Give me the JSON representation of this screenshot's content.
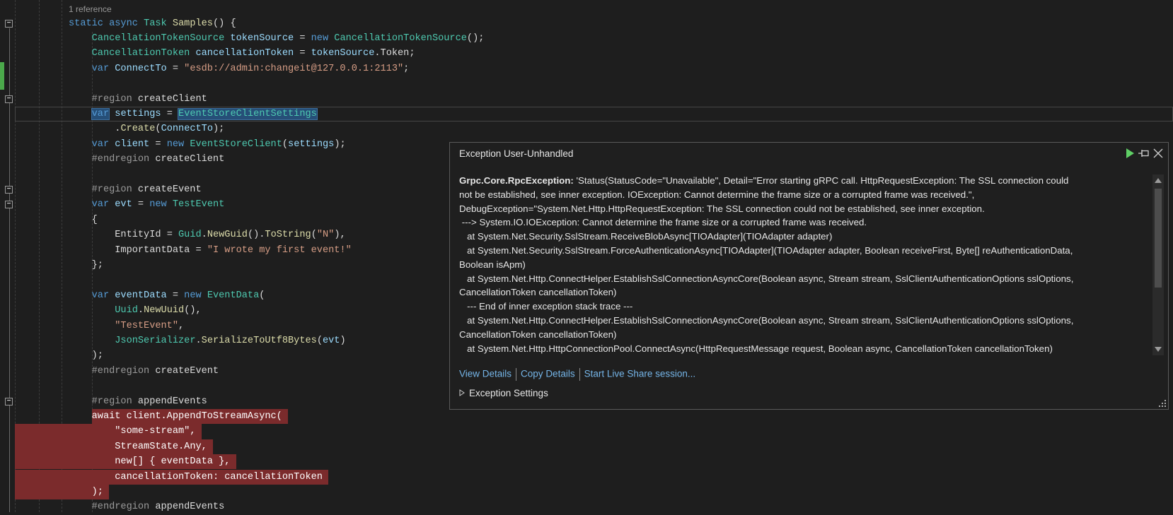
{
  "editor": {
    "codelens": "1 reference",
    "lines": [
      {
        "i": 0,
        "t": [
          [
            "static ",
            "k"
          ],
          [
            "async ",
            "k"
          ],
          [
            "Task ",
            "t"
          ],
          [
            "Samples",
            "m"
          ],
          [
            "() {",
            "d"
          ]
        ]
      },
      {
        "i": 4,
        "t": [
          [
            "CancellationTokenSource ",
            "t"
          ],
          [
            "tokenSource",
            "v"
          ],
          [
            " = ",
            "d"
          ],
          [
            "new ",
            "k"
          ],
          [
            "CancellationTokenSource",
            "t"
          ],
          [
            "();",
            "d"
          ]
        ]
      },
      {
        "i": 4,
        "t": [
          [
            "CancellationToken ",
            "t"
          ],
          [
            "cancellationToken",
            "v"
          ],
          [
            " = ",
            "d"
          ],
          [
            "tokenSource",
            "v"
          ],
          [
            ".Token;",
            "d"
          ]
        ]
      },
      {
        "i": 4,
        "t": [
          [
            "var ",
            "k"
          ],
          [
            "ConnectTo",
            "v"
          ],
          [
            " = ",
            "d"
          ],
          [
            "\"esdb://admin:changeit@127.0.0.1:2113\"",
            "s"
          ],
          [
            ";",
            "d"
          ]
        ]
      },
      {
        "i": 0,
        "t": []
      },
      {
        "i": 4,
        "t": [
          [
            "#region ",
            "p"
          ],
          [
            "createClient",
            "d"
          ]
        ]
      },
      {
        "i": 4,
        "current": true,
        "t": [
          [
            "var",
            "k sel"
          ],
          [
            " ",
            "d"
          ],
          [
            "settings",
            "v"
          ],
          [
            " = ",
            "d"
          ],
          [
            "EventStoreClientSettings",
            "t sel"
          ]
        ]
      },
      {
        "i": 8,
        "t": [
          [
            ".",
            "d"
          ],
          [
            "Create",
            "m"
          ],
          [
            "(",
            "d"
          ],
          [
            "ConnectTo",
            "v"
          ],
          [
            ");",
            "d"
          ]
        ]
      },
      {
        "i": 4,
        "t": [
          [
            "var ",
            "k"
          ],
          [
            "client",
            "v"
          ],
          [
            " = ",
            "d"
          ],
          [
            "new ",
            "k"
          ],
          [
            "EventStoreClient",
            "t"
          ],
          [
            "(",
            "d"
          ],
          [
            "settings",
            "v"
          ],
          [
            ");",
            "d"
          ]
        ]
      },
      {
        "i": 4,
        "t": [
          [
            "#endregion ",
            "p"
          ],
          [
            "createClient",
            "d"
          ]
        ]
      },
      {
        "i": 0,
        "t": []
      },
      {
        "i": 4,
        "t": [
          [
            "#region ",
            "p"
          ],
          [
            "createEvent",
            "d"
          ]
        ]
      },
      {
        "i": 4,
        "t": [
          [
            "var ",
            "k"
          ],
          [
            "evt",
            "v"
          ],
          [
            " = ",
            "d"
          ],
          [
            "new ",
            "k"
          ],
          [
            "TestEvent",
            "t"
          ]
        ]
      },
      {
        "i": 4,
        "t": [
          [
            "{",
            "d"
          ]
        ]
      },
      {
        "i": 8,
        "t": [
          [
            "EntityId",
            "d"
          ],
          [
            " = ",
            "d"
          ],
          [
            "Guid",
            "t"
          ],
          [
            ".",
            "d"
          ],
          [
            "NewGuid",
            "m"
          ],
          [
            "().",
            "d"
          ],
          [
            "ToString",
            "m"
          ],
          [
            "(",
            "d"
          ],
          [
            "\"N\"",
            "s"
          ],
          [
            "),",
            "d"
          ]
        ]
      },
      {
        "i": 8,
        "t": [
          [
            "ImportantData",
            "d"
          ],
          [
            " = ",
            "d"
          ],
          [
            "\"I wrote my first event!\"",
            "s"
          ]
        ]
      },
      {
        "i": 4,
        "t": [
          [
            "};",
            "d"
          ]
        ]
      },
      {
        "i": 0,
        "t": []
      },
      {
        "i": 4,
        "t": [
          [
            "var ",
            "k"
          ],
          [
            "eventData",
            "v"
          ],
          [
            " = ",
            "d"
          ],
          [
            "new ",
            "k"
          ],
          [
            "EventData",
            "t"
          ],
          [
            "(",
            "d"
          ]
        ]
      },
      {
        "i": 8,
        "t": [
          [
            "Uuid",
            "t"
          ],
          [
            ".",
            "d"
          ],
          [
            "NewUuid",
            "m"
          ],
          [
            "(),",
            "d"
          ]
        ]
      },
      {
        "i": 8,
        "t": [
          [
            "\"TestEvent\"",
            "s"
          ],
          [
            ",",
            "d"
          ]
        ]
      },
      {
        "i": 8,
        "t": [
          [
            "JsonSerializer",
            "t"
          ],
          [
            ".",
            "d"
          ],
          [
            "SerializeToUtf8Bytes",
            "m"
          ],
          [
            "(",
            "d"
          ],
          [
            "evt",
            "v"
          ],
          [
            ")",
            "d"
          ]
        ]
      },
      {
        "i": 4,
        "t": [
          [
            ");",
            "d"
          ]
        ]
      },
      {
        "i": 4,
        "t": [
          [
            "#endregion ",
            "p"
          ],
          [
            "createEvent",
            "d"
          ]
        ]
      },
      {
        "i": 0,
        "t": []
      },
      {
        "i": 4,
        "t": [
          [
            "#region ",
            "p"
          ],
          [
            "appendEvents",
            "d"
          ]
        ]
      },
      {
        "i": 4,
        "hl": "start",
        "t": [
          [
            "await client.AppendToStreamAsync( ",
            "w"
          ]
        ]
      },
      {
        "i": 8,
        "hl": "full",
        "t": [
          [
            "\"some-stream\", ",
            "w"
          ]
        ]
      },
      {
        "i": 8,
        "hl": "full",
        "t": [
          [
            "StreamState.Any, ",
            "w"
          ]
        ]
      },
      {
        "i": 8,
        "hl": "full",
        "t": [
          [
            "new[] { eventData }, ",
            "w"
          ]
        ]
      },
      {
        "i": 8,
        "hl": "full",
        "t": [
          [
            "cancellationToken: cancellationToken ",
            "w"
          ]
        ]
      },
      {
        "i": 4,
        "hl": "full",
        "t": [
          [
            "); ",
            "w"
          ]
        ]
      },
      {
        "i": 4,
        "t": [
          [
            "#endregion ",
            "p"
          ],
          [
            "appendEvents",
            "d"
          ]
        ]
      }
    ]
  },
  "exception_popup": {
    "title": "Exception User-Unhandled",
    "exception_type": "Grpc.Core.RpcException:",
    "message_lines": [
      " 'Status(StatusCode=\"Unavailable\", Detail=\"Error starting gRPC call. HttpRequestException: The SSL connection could",
      "not be established, see inner exception. IOException: Cannot determine the frame size or a corrupted frame was received.\",",
      "DebugException=\"System.Net.Http.HttpRequestException: The SSL connection could not be established, see inner exception.",
      " ---> System.IO.IOException: Cannot determine the frame size or a corrupted frame was received.",
      "   at System.Net.Security.SslStream.ReceiveBlobAsync[TIOAdapter](TIOAdapter adapter)",
      "   at System.Net.Security.SslStream.ForceAuthenticationAsync[TIOAdapter](TIOAdapter adapter, Boolean receiveFirst, Byte[] reAuthenticationData,",
      "Boolean isApm)",
      "   at System.Net.Http.ConnectHelper.EstablishSslConnectionAsyncCore(Boolean async, Stream stream, SslClientAuthenticationOptions sslOptions,",
      "CancellationToken cancellationToken)",
      "   --- End of inner exception stack trace ---",
      "   at System.Net.Http.ConnectHelper.EstablishSslConnectionAsyncCore(Boolean async, Stream stream, SslClientAuthenticationOptions sslOptions,",
      "CancellationToken cancellationToken)",
      "   at System.Net.Http.HttpConnectionPool.ConnectAsync(HttpRequestMessage request, Boolean async, CancellationToken cancellationToken)"
    ],
    "links": {
      "view_details": "View Details",
      "copy_details": "Copy Details",
      "live_share": "Start Live Share session..."
    },
    "exception_settings": "Exception Settings",
    "icons": [
      "continue-icon",
      "pin-icon",
      "close-icon"
    ],
    "colors": {
      "continue": "#5fcf65",
      "link": "#75b5e8",
      "current_statement": "#7b2b2c"
    }
  }
}
